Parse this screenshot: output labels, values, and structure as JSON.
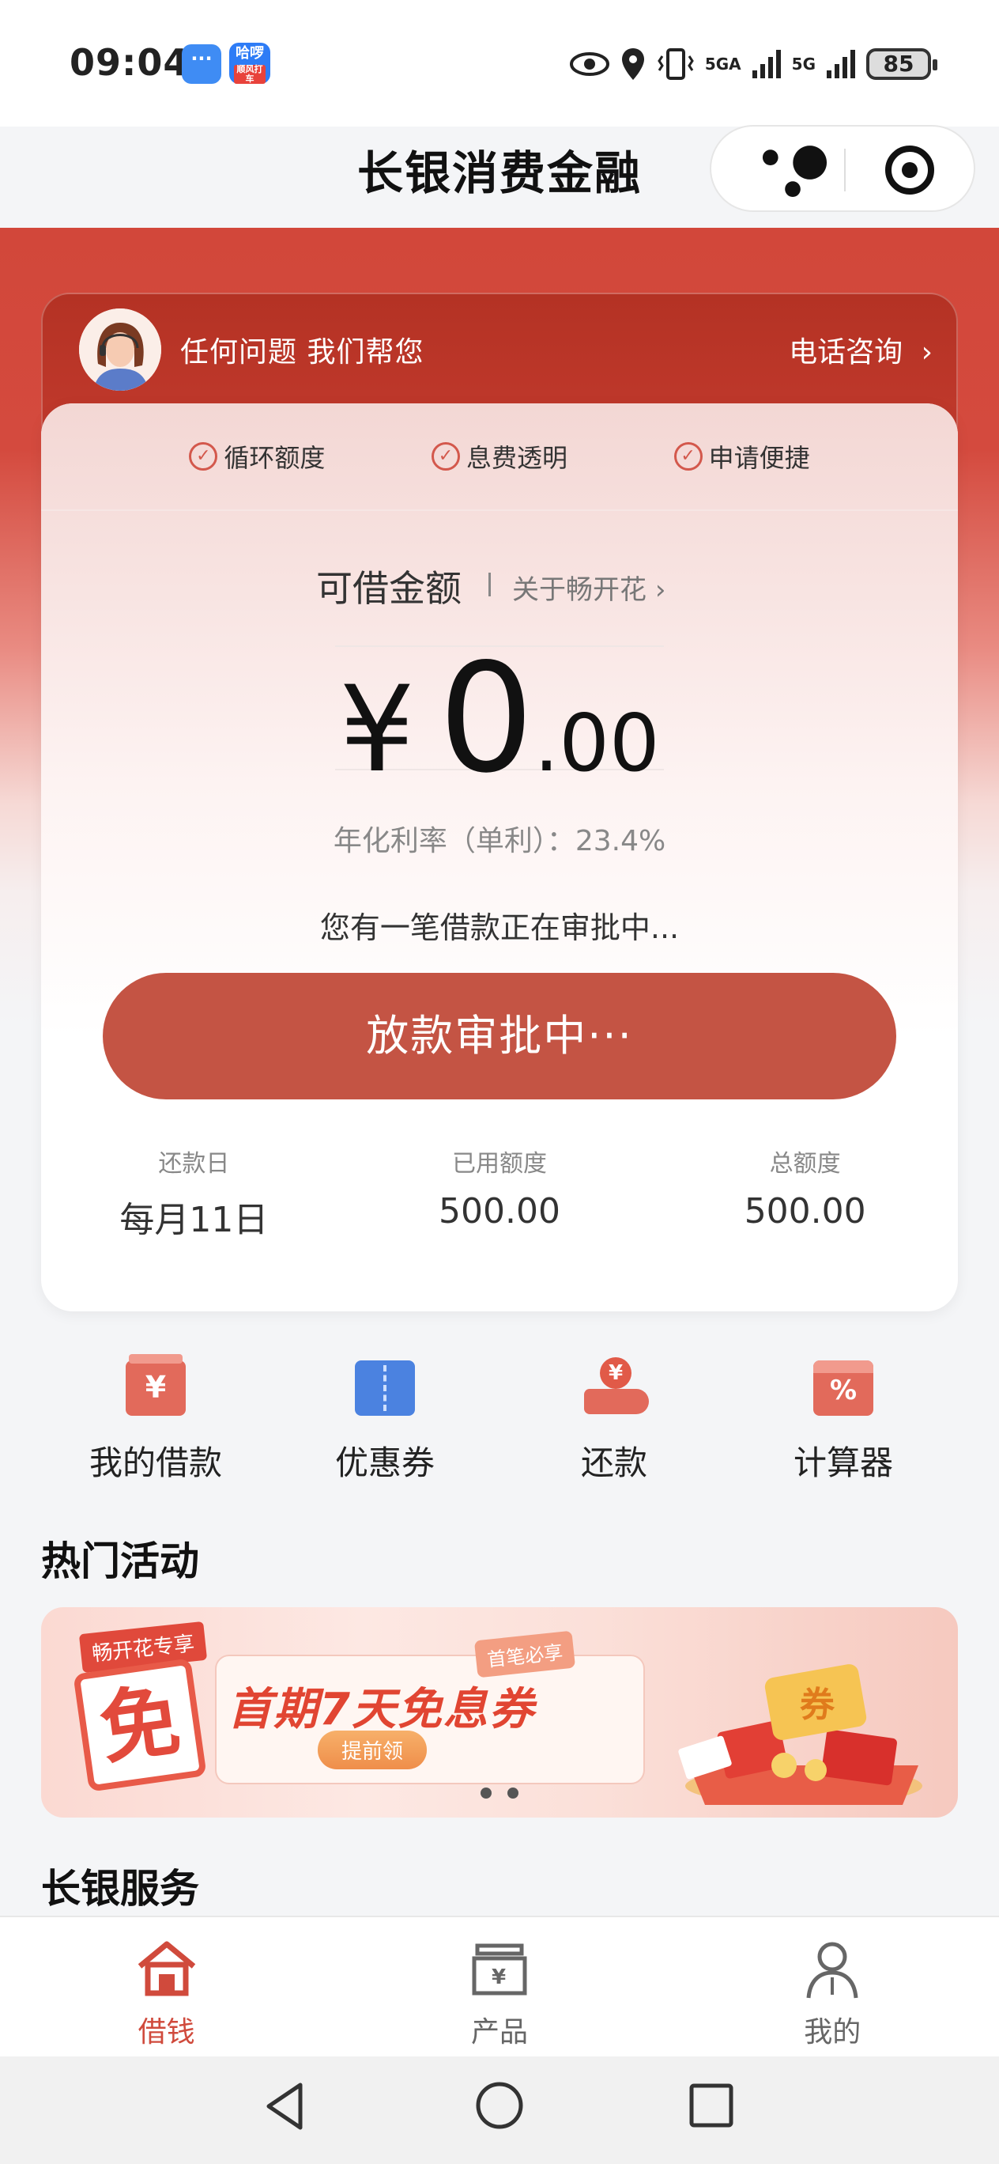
{
  "status_bar": {
    "time": "09:04",
    "notif_app2": "哈啰",
    "notif_app2_sub": "顺风打车",
    "net1": "5GA",
    "net2": "5G",
    "battery": "85"
  },
  "header": {
    "title": "长银消费金融"
  },
  "consult": {
    "text": "任何问题 我们帮您",
    "phone": "电话咨询"
  },
  "features": [
    {
      "label": "循环额度"
    },
    {
      "label": "息费透明"
    },
    {
      "label": "申请便捷"
    }
  ],
  "credit": {
    "label": "可借金额",
    "about": "关于畅开花",
    "currency": "¥",
    "amount_int": "0",
    "amount_dec": ".00",
    "rate": "年化利率（单利）：23.4%",
    "pending": "您有一笔借款正在审批中...",
    "button": "放款审批中···"
  },
  "stats": [
    {
      "label": "还款日",
      "value": "每月11日"
    },
    {
      "label": "已用额度",
      "value": "500.00"
    },
    {
      "label": "总额度",
      "value": "500.00"
    }
  ],
  "quick_actions": [
    {
      "label": "我的借款",
      "icon": "loan-icon"
    },
    {
      "label": "优惠券",
      "icon": "coupon-icon"
    },
    {
      "label": "还款",
      "icon": "repay-icon"
    },
    {
      "label": "计算器",
      "icon": "calculator-icon"
    }
  ],
  "hot": {
    "title": "热门活动",
    "banner_tag": "畅开花专享",
    "banner_free": "免",
    "banner_must": "首笔必享",
    "banner_headline": "首期7天免息券",
    "banner_button": "提前领",
    "banner_coupon_char": "券"
  },
  "services": {
    "title": "长银服务"
  },
  "tabbar": [
    {
      "label": "借钱",
      "active": true
    },
    {
      "label": "产品",
      "active": false
    },
    {
      "label": "我的",
      "active": false
    }
  ],
  "colors": {
    "brand_red": "#d2473a",
    "button_red": "#c45444",
    "active_tab": "#d04a3c",
    "inactive_tab": "#777777"
  }
}
